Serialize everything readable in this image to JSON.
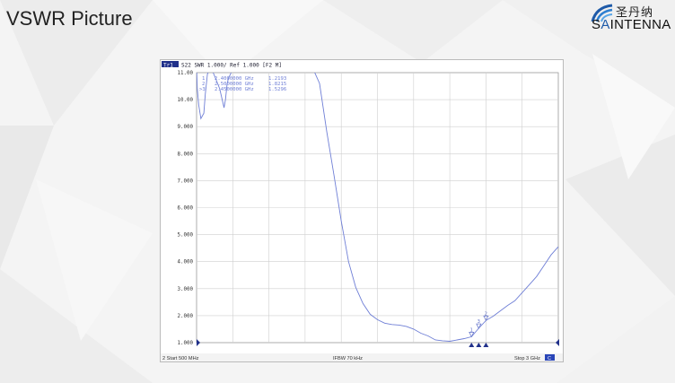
{
  "slide": {
    "title": "VSWR Picture",
    "logo_cn": "圣丹纳",
    "logo_en_prefix": "S",
    "logo_en_accent": "A",
    "logo_en_rest": "INTENNA"
  },
  "analyzer": {
    "trace_tag": "Tr1",
    "header_text": "S22  SWR 1.000/ Ref 1.000  [F2 M]",
    "footer_left": "2  Start 500 MHz",
    "footer_center": "IFBW 70 kHz",
    "footer_right": "Stop 3 GHz",
    "footer_badge": "C",
    "markers": [
      {
        "id": "1",
        "freq": "2.4000000 GHz",
        "value": "1.2193"
      },
      {
        "id": "2",
        "freq": "2.5000000 GHz",
        "value": "1.8215"
      },
      {
        "id": ">3",
        "freq": "2.4500000 GHz",
        "value": "1.5296"
      }
    ]
  },
  "chart_data": {
    "type": "line",
    "title": "",
    "xlabel": "",
    "ylabel": "",
    "xlim": [
      500,
      3000
    ],
    "ylim": [
      1.0,
      11.0
    ],
    "yticks": [
      "11.00",
      "10.00",
      "9.000",
      "8.000",
      "7.000",
      "6.000",
      "5.000",
      "4.000",
      "3.000",
      "2.000",
      "1.000"
    ],
    "grid": true,
    "series": [
      {
        "color": "#6f7fd6",
        "x": [
          500,
          505,
          515,
          530,
          550,
          560,
          575,
          600,
          615,
          630,
          645,
          660,
          675,
          690,
          700,
          710,
          720,
          735,
          750,
          800,
          850,
          900,
          950,
          1000,
          1050,
          1100,
          1150,
          1200,
          1250,
          1300,
          1350,
          1400,
          1450,
          1500,
          1550,
          1600,
          1650,
          1700,
          1750,
          1800,
          1850,
          1900,
          1950,
          2000,
          2050,
          2100,
          2150,
          2200,
          2250,
          2300,
          2350,
          2400,
          2450,
          2500,
          2550,
          2600,
          2650,
          2700,
          2750,
          2800,
          2850,
          2900,
          2950,
          3000
        ],
        "y": [
          11.2,
          10.4,
          9.8,
          9.3,
          9.5,
          10.2,
          10.95,
          11.2,
          11.0,
          10.8,
          10.6,
          10.4,
          10.05,
          9.7,
          10.0,
          10.55,
          10.8,
          10.95,
          11.2,
          11.2,
          11.2,
          11.2,
          11.2,
          11.2,
          11.2,
          11.2,
          11.2,
          11.2,
          11.2,
          11.2,
          10.6,
          8.8,
          7.2,
          5.5,
          4.0,
          3.05,
          2.45,
          2.05,
          1.85,
          1.72,
          1.67,
          1.65,
          1.6,
          1.5,
          1.35,
          1.25,
          1.1,
          1.07,
          1.05,
          1.1,
          1.15,
          1.22,
          1.53,
          1.82,
          1.98,
          2.18,
          2.38,
          2.55,
          2.85,
          3.15,
          3.45,
          3.85,
          4.25,
          4.55
        ]
      }
    ],
    "markers": [
      {
        "id": "1",
        "x": 2400,
        "y": 1.2193
      },
      {
        "id": "2",
        "x": 2500,
        "y": 1.8215
      },
      {
        "id": "3",
        "x": 2450,
        "y": 1.5296
      }
    ]
  }
}
